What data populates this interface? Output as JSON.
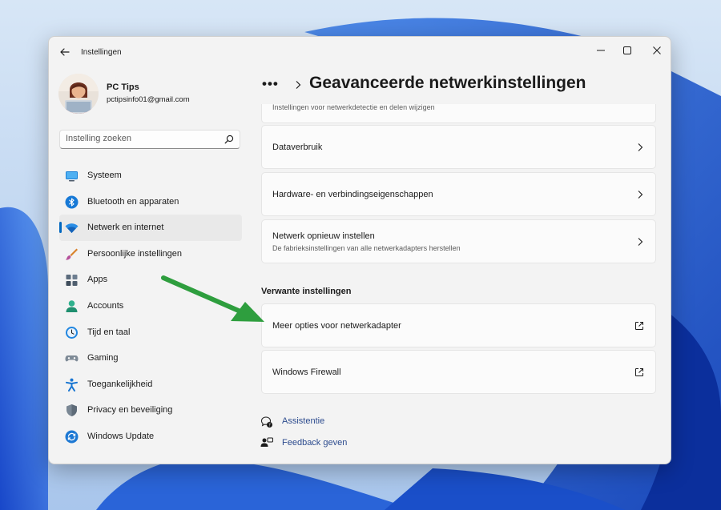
{
  "window": {
    "title": "Instellingen",
    "controls": [
      "minimize",
      "maximize",
      "close"
    ]
  },
  "profile": {
    "name": "PC Tips",
    "email": "pctipsinfo01@gmail.com"
  },
  "search": {
    "placeholder": "Instelling zoeken"
  },
  "sidebar": {
    "selected_index": 2,
    "items": [
      {
        "label": "Systeem",
        "icon": "system-icon"
      },
      {
        "label": "Bluetooth en apparaten",
        "icon": "bluetooth-icon"
      },
      {
        "label": "Netwerk en internet",
        "icon": "wifi-icon"
      },
      {
        "label": "Persoonlijke instellingen",
        "icon": "brush-icon"
      },
      {
        "label": "Apps",
        "icon": "apps-icon"
      },
      {
        "label": "Accounts",
        "icon": "accounts-icon"
      },
      {
        "label": "Tijd en taal",
        "icon": "clock-globe-icon"
      },
      {
        "label": "Gaming",
        "icon": "gamepad-icon"
      },
      {
        "label": "Toegankelijkheid",
        "icon": "accessibility-icon"
      },
      {
        "label": "Privacy en beveiliging",
        "icon": "shield-icon"
      },
      {
        "label": "Windows Update",
        "icon": "update-icon"
      }
    ]
  },
  "header": {
    "breadcrumb_more": "•••",
    "title": "Geavanceerde netwerkinstellingen"
  },
  "cards": {
    "partial_sub": "Instellingen voor netwerkdetectie en delen wijzigen",
    "data_usage": "Dataverbruik",
    "hardware": "Hardware- en verbindingseigenschappen",
    "reset_title": "Netwerk opnieuw instellen",
    "reset_sub": "De fabrieksinstellingen van alle netwerkadapters herstellen"
  },
  "related": {
    "title": "Verwante instellingen",
    "adapter_options": "Meer opties voor netwerkadapter",
    "firewall": "Windows Firewall"
  },
  "help": {
    "assist": "Assistentie",
    "feedback": "Feedback geven"
  },
  "colors": {
    "accent": "#0067c0",
    "annotation_arrow": "#2e9e3e",
    "link": "#2c4b8e"
  }
}
